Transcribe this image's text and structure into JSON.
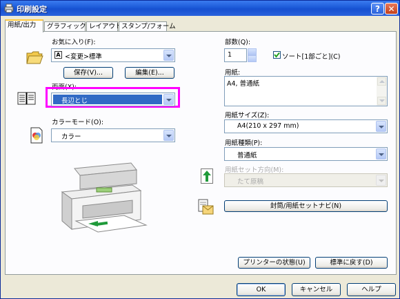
{
  "window": {
    "title": "印刷設定",
    "help_label": "?",
    "close_label": "✕"
  },
  "tabs": [
    {
      "label": "用紙/出力"
    },
    {
      "label": "グラフィックス"
    },
    {
      "label": "レイアウト"
    },
    {
      "label": "スタンプ/フォーム"
    }
  ],
  "favorites": {
    "label": "お気に入り(F):",
    "value": "<変更>標準",
    "save_label": "保存(V)...",
    "edit_label": "編集(E)..."
  },
  "duplex": {
    "label": "両面(X):",
    "value": "長辺とじ",
    "highlight_color": "#ff00ff"
  },
  "color_mode": {
    "label": "カラーモード(O):",
    "value": "カラー"
  },
  "copies": {
    "label": "部数(Q):",
    "value": "1",
    "collate_label": "ソート[1部ごと](C)",
    "collate_checked": true
  },
  "paper": {
    "label": "用紙:",
    "value": "A4, 普通紙"
  },
  "paper_size": {
    "label": "用紙サイズ(Z):",
    "value": "A4(210 x 297 mm)"
  },
  "paper_type": {
    "label": "用紙種類(P):",
    "value": "普通紙"
  },
  "paper_orientation": {
    "label": "用紙セット方向(M):",
    "value": "たて原稿",
    "enabled": false
  },
  "envelope_button": {
    "label": "封筒/用紙セットナビ(N)"
  },
  "status_button": {
    "label": "プリンターの状態(U)"
  },
  "defaults_button": {
    "label": "標準に戻す(D)"
  },
  "dialog_buttons": {
    "ok": "OK",
    "cancel": "キャンセル",
    "help": "ヘルプ"
  },
  "icons": {
    "title": "printer-icon",
    "favorites": "folder-icon",
    "duplex": "duplex-document-icon",
    "color": "color-mode-icon",
    "orientation": "up-arrow-icon",
    "envelope": "envelope-paper-icon",
    "illustration": "printer-illustration"
  },
  "accent_colors": {
    "titlebar": "#1c5ad8",
    "selection": "#316ac5",
    "tab_highlight": "#ffc83c"
  }
}
